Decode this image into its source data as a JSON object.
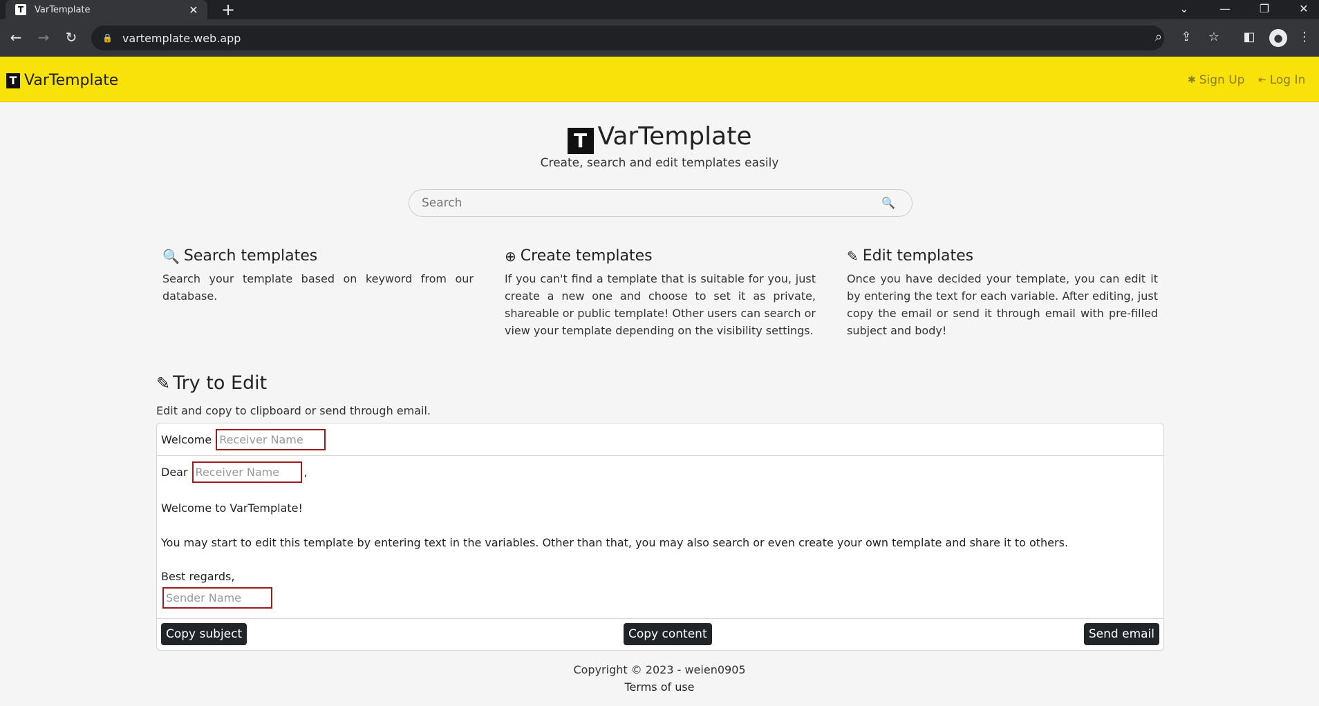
{
  "browser": {
    "tab_title": "VarTemplate",
    "tab_close": "✕",
    "new_tab": "+",
    "url": "vartemplate.web.app",
    "controls": {
      "dropdown": "⌄",
      "minimize": "—",
      "restore": "❐",
      "close": "✕"
    },
    "nav": {
      "back": "←",
      "forward": "→",
      "reload": "↻"
    },
    "icons": [
      "zoom-icon",
      "share-icon",
      "star-icon",
      "sidepanel-icon",
      "profile-icon",
      "menu-icon"
    ]
  },
  "navbar": {
    "brand": "VarTemplate",
    "signup": "Sign Up",
    "login": "Log In",
    "bg_color": "#f9e10a"
  },
  "hero": {
    "title": "VarTemplate",
    "subtitle": "Create, search and edit templates easily",
    "search_placeholder": "Search"
  },
  "features": [
    {
      "title": "Search templates",
      "icon": "search-icon",
      "text": "Search your template based on keyword from our database."
    },
    {
      "title": "Create templates",
      "icon": "plus-circle-icon",
      "text": "If you can't find a template that is suitable for you, just create a new one and choose to set it as private, shareable or public template! Other users can search or view your template depending on the visibility settings."
    },
    {
      "title": "Edit templates",
      "icon": "pencil-icon",
      "text": "Once you have decided your template, you can edit it by entering the text for each variable. After editing, just copy the email or send it through email with pre-filled subject and body!"
    }
  ],
  "try_edit": {
    "title": "Try to Edit",
    "subtitle": "Edit and copy to clipboard or send through email.",
    "subject_prefix": "Welcome",
    "receiver_placeholder": "Receiver Name",
    "greeting": "Dear",
    "comma": ",",
    "welcome_line": "Welcome to VarTemplate!",
    "body_line": "You may start to edit this template by entering text in the variables. Other than that, you may also search or even create your own template and share it to others.",
    "closing": "Best regards,",
    "sender_placeholder": "Sender Name",
    "copy_subject": "Copy subject",
    "copy_content": "Copy content",
    "send_email": "Send email"
  },
  "footer": {
    "copyright": "Copyright © 2023 - weien0905",
    "terms": "Terms of use"
  }
}
